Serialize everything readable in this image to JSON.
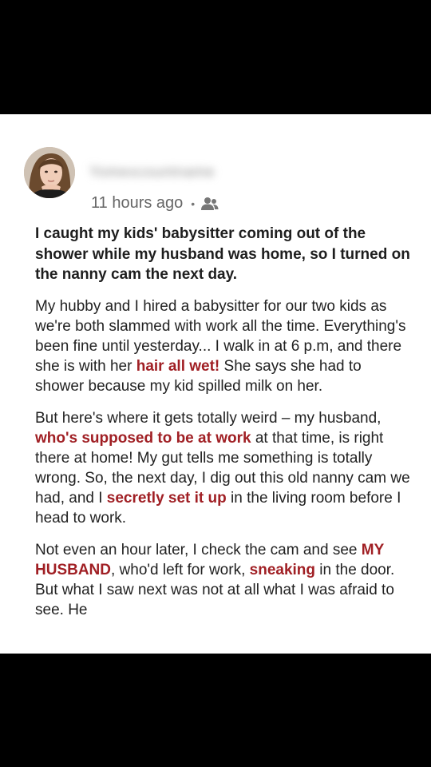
{
  "post": {
    "username": "Yomexcountname",
    "timestamp": "11 hours ago",
    "separator": "•",
    "audience_icon": "friends-icon",
    "headline": "I caught my kids' babysitter coming out of the shower while my husband was home, so I turned on the nanny cam the next day.",
    "p1": {
      "a": "My hubby and I hired a babysitter for our two kids as we're both slammed with work all the time. Everything's been fine until yesterday... I walk in at 6 p.m, and there she is with her ",
      "b": "hair all wet!",
      "c": " She says she had to shower because my kid spilled milk on her."
    },
    "p2": {
      "a": "But here's where it gets totally weird – my husband, ",
      "b": "who's supposed to be at work",
      "c": " at that time, is right there at home! My gut tells me something is totally wrong. So, the next day, I dig out this old nanny cam we had, and I ",
      "d": "secretly set it up",
      "e": " in the living room before I head to work."
    },
    "p3": {
      "a": "Not even an hour later, I check the cam and see ",
      "b": "MY HUSBAND",
      "c": ", who'd left for work, ",
      "d": "sneaking",
      "e": " in the door. But what I saw next was not at all what I was afraid to see. He"
    }
  },
  "colors": {
    "highlight": "#a01f24",
    "background": "#000000",
    "card": "#ffffff"
  }
}
